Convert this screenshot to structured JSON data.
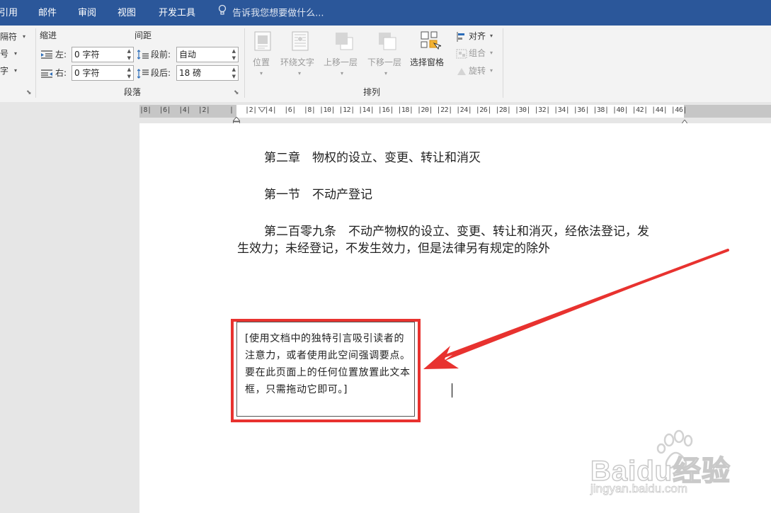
{
  "tabs": [
    "引用",
    "邮件",
    "审阅",
    "视图",
    "开发工具"
  ],
  "tell_me": "告诉我您想要做什么...",
  "ribbon": {
    "left_cut": [
      "隔符",
      "号",
      "字"
    ],
    "indent_label": "缩进",
    "spacing_label": "间距",
    "left_label": "左:",
    "right_label": "右:",
    "before_label": "段前:",
    "after_label": "段后:",
    "left_value": "0 字符",
    "right_value": "0 字符",
    "before_value": "自动",
    "after_value": "18 磅",
    "paragraph_group": "段落",
    "arrange_group": "排列",
    "position": "位置",
    "wrap_text": "环绕文字",
    "bring_forward": "上移一层",
    "send_backward": "下移一层",
    "selection_pane": "选择窗格",
    "align": "对齐",
    "group": "组合",
    "rotate": "旋转"
  },
  "ruler": {
    "numbers": "|8|  |6|  |4|  |2|     |   |2|  |4|  |6|  |8| |10| |12| |14| |16| |18| |20| |22| |24| |26| |28| |30| |32| |34| |36| |38| |40| |42| |44| |46|"
  },
  "document": {
    "chapter": "第二章　物权的设立、变更、转让和消灭",
    "section": "第一节　不动产登记",
    "article_line1": "第二百零九条　不动产物权的设立、变更、转让和消灭，经依法登记，发",
    "article_line2": "生效力；未经登记，不发生效力，但是法律另有规定的除外"
  },
  "textbox": {
    "text": "[使用文档中的独特引言吸引读者的注意力，或者使用此空间强调要点。要在此页面上的任何位置放置此文本框，只需拖动它即可。]"
  },
  "watermark": {
    "brand": "Baidu经验",
    "url": "jingyan.baidu.com"
  },
  "colors": {
    "title_bar": "#2b579a",
    "highlight": "#e8322f"
  }
}
